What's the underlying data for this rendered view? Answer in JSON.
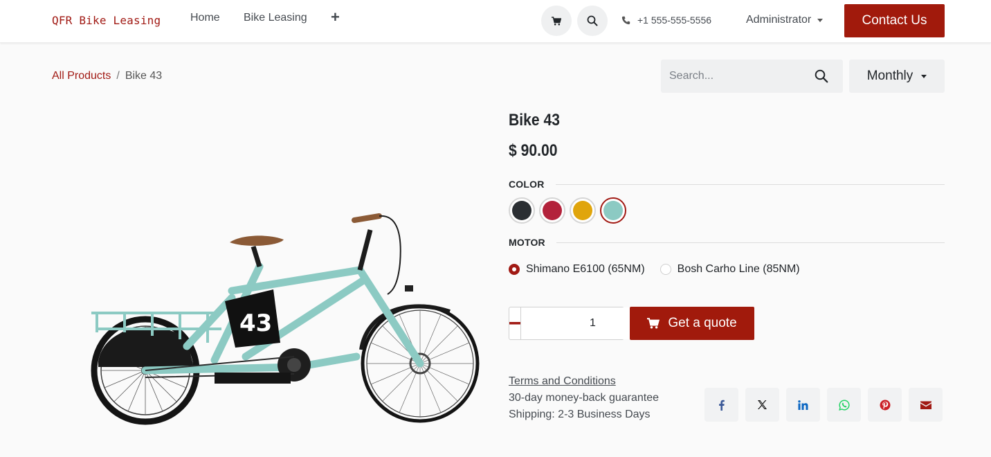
{
  "header": {
    "logo": "QFR Bike Leasing",
    "nav": [
      {
        "label": "Home"
      },
      {
        "label": "Bike Leasing"
      }
    ],
    "add_menu_glyph": "+",
    "phone": "+1 555-555-5556",
    "user": "Administrator",
    "contact_label": "Contact Us"
  },
  "breadcrumb": {
    "parent": "All Products",
    "separator": "/",
    "current": "Bike 43"
  },
  "search": {
    "placeholder": "Search..."
  },
  "pricelist": {
    "selected": "Monthly"
  },
  "product": {
    "name": "Bike 43",
    "price": "$ 90.00",
    "frame_number": "43",
    "attributes": {
      "color": {
        "label": "COLOR",
        "options": [
          {
            "color": "#2b2f33",
            "selected": false
          },
          {
            "color": "#b3223b",
            "selected": false
          },
          {
            "color": "#e0a50c",
            "selected": false
          },
          {
            "color": "#8ccac3",
            "selected": true
          }
        ]
      },
      "motor": {
        "label": "MOTOR",
        "options": [
          {
            "label": "Shimano E6100 (65NM)",
            "selected": true
          },
          {
            "label": "Bosh Carho Line (85NM)",
            "selected": false
          }
        ]
      }
    },
    "quantity": "1",
    "quote_label": "Get a quote",
    "terms_label": "Terms and Conditions",
    "guarantee": "30-day money-back guarantee",
    "shipping": "Shipping: 2-3 Business Days"
  },
  "share": [
    {
      "icon": "facebook-icon"
    },
    {
      "icon": "x-twitter-icon"
    },
    {
      "icon": "linkedin-icon"
    },
    {
      "icon": "whatsapp-icon"
    },
    {
      "icon": "pinterest-icon"
    },
    {
      "icon": "email-icon"
    }
  ],
  "colors": {
    "brand": "#a11a14",
    "bike_frame": "#8ccac3"
  }
}
